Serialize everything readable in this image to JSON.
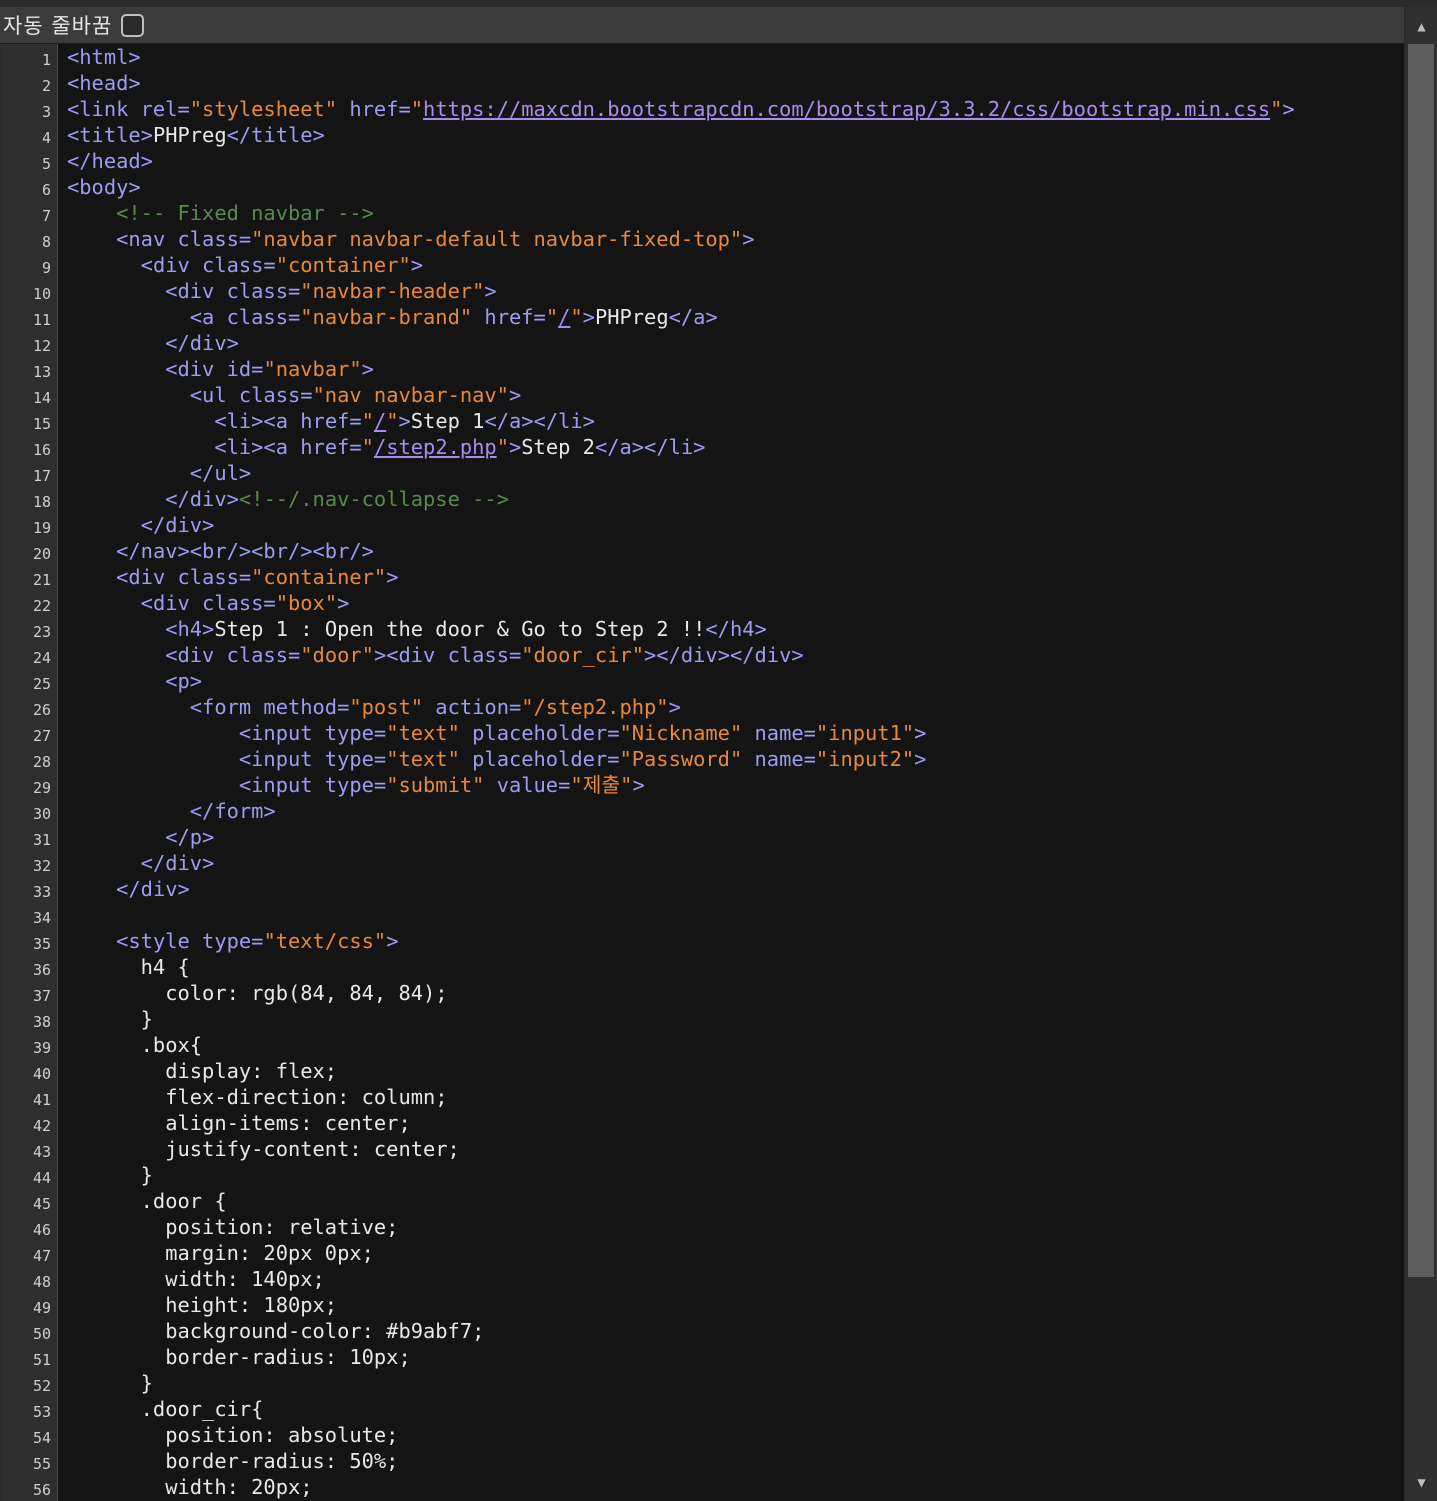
{
  "toolbar": {
    "wrap_label": "자동 줄바꿈",
    "wrap_checked": false
  },
  "scrollbar": {
    "up_icon": "▲",
    "down_icon": "▼"
  },
  "colors": {
    "tag": "#9c9cf2",
    "string": "#e8893a",
    "comment": "#5a8a4a",
    "link": "#a98cf0",
    "text": "#e8e8e8",
    "background": "#141414"
  },
  "code": [
    {
      "n": "1",
      "p": [
        [
          "<html>",
          "t"
        ]
      ]
    },
    {
      "n": "2",
      "p": [
        [
          "<head>",
          "t"
        ]
      ]
    },
    {
      "n": "3",
      "p": [
        [
          "<link rel=",
          "t"
        ],
        [
          "\"stylesheet\"",
          "s"
        ],
        [
          " href=",
          "t"
        ],
        [
          "\"",
          "s"
        ],
        [
          "https://maxcdn.bootstrapcdn.com/bootstrap/3.3.2/css/bootstrap.min.css",
          "u"
        ],
        [
          "\"",
          "s"
        ],
        [
          ">",
          "t"
        ]
      ]
    },
    {
      "n": "4",
      "p": [
        [
          "<title>",
          "t"
        ],
        [
          "PHPreg",
          ""
        ],
        [
          "</title>",
          "t"
        ]
      ]
    },
    {
      "n": "5",
      "p": [
        [
          "</head>",
          "t"
        ]
      ]
    },
    {
      "n": "6",
      "p": [
        [
          "<body>",
          "t"
        ]
      ]
    },
    {
      "n": "7",
      "p": [
        [
          "    ",
          ""
        ],
        [
          "<!-- Fixed navbar -->",
          "c"
        ]
      ]
    },
    {
      "n": "8",
      "p": [
        [
          "    ",
          ""
        ],
        [
          "<nav class=",
          "t"
        ],
        [
          "\"navbar navbar-default navbar-fixed-top\"",
          "s"
        ],
        [
          ">",
          "t"
        ]
      ]
    },
    {
      "n": "9",
      "p": [
        [
          "      ",
          ""
        ],
        [
          "<div class=",
          "t"
        ],
        [
          "\"container\"",
          "s"
        ],
        [
          ">",
          "t"
        ]
      ]
    },
    {
      "n": "10",
      "p": [
        [
          "        ",
          ""
        ],
        [
          "<div class=",
          "t"
        ],
        [
          "\"navbar-header\"",
          "s"
        ],
        [
          ">",
          "t"
        ]
      ]
    },
    {
      "n": "11",
      "p": [
        [
          "          ",
          ""
        ],
        [
          "<a class=",
          "t"
        ],
        [
          "\"navbar-brand\"",
          "s"
        ],
        [
          " href=",
          "t"
        ],
        [
          "\"",
          "s"
        ],
        [
          "/",
          "u"
        ],
        [
          "\"",
          "s"
        ],
        [
          ">",
          "t"
        ],
        [
          "PHPreg",
          ""
        ],
        [
          "</a>",
          "t"
        ]
      ]
    },
    {
      "n": "12",
      "p": [
        [
          "        ",
          ""
        ],
        [
          "</div>",
          "t"
        ]
      ]
    },
    {
      "n": "13",
      "p": [
        [
          "        ",
          ""
        ],
        [
          "<div id=",
          "t"
        ],
        [
          "\"navbar\"",
          "s"
        ],
        [
          ">",
          "t"
        ]
      ]
    },
    {
      "n": "14",
      "p": [
        [
          "          ",
          ""
        ],
        [
          "<ul class=",
          "t"
        ],
        [
          "\"nav navbar-nav\"",
          "s"
        ],
        [
          ">",
          "t"
        ]
      ]
    },
    {
      "n": "15",
      "p": [
        [
          "            ",
          ""
        ],
        [
          "<li><a href=",
          "t"
        ],
        [
          "\"",
          "s"
        ],
        [
          "/",
          "u"
        ],
        [
          "\"",
          "s"
        ],
        [
          ">",
          "t"
        ],
        [
          "Step 1",
          ""
        ],
        [
          "</a></li>",
          "t"
        ]
      ]
    },
    {
      "n": "16",
      "p": [
        [
          "            ",
          ""
        ],
        [
          "<li><a href=",
          "t"
        ],
        [
          "\"",
          "s"
        ],
        [
          "/step2.php",
          "u"
        ],
        [
          "\"",
          "s"
        ],
        [
          ">",
          "t"
        ],
        [
          "Step 2",
          ""
        ],
        [
          "</a></li>",
          "t"
        ]
      ]
    },
    {
      "n": "17",
      "p": [
        [
          "          ",
          ""
        ],
        [
          "</ul>",
          "t"
        ]
      ]
    },
    {
      "n": "18",
      "p": [
        [
          "        ",
          ""
        ],
        [
          "</div>",
          "t"
        ],
        [
          "<!--/.nav-collapse -->",
          "c"
        ]
      ]
    },
    {
      "n": "19",
      "p": [
        [
          "      ",
          ""
        ],
        [
          "</div>",
          "t"
        ]
      ]
    },
    {
      "n": "20",
      "p": [
        [
          "    ",
          ""
        ],
        [
          "</nav><br/><br/><br/>",
          "t"
        ]
      ]
    },
    {
      "n": "21",
      "p": [
        [
          "    ",
          ""
        ],
        [
          "<div class=",
          "t"
        ],
        [
          "\"container\"",
          "s"
        ],
        [
          ">",
          "t"
        ]
      ]
    },
    {
      "n": "22",
      "p": [
        [
          "      ",
          ""
        ],
        [
          "<div class=",
          "t"
        ],
        [
          "\"box\"",
          "s"
        ],
        [
          ">",
          "t"
        ]
      ]
    },
    {
      "n": "23",
      "p": [
        [
          "        ",
          ""
        ],
        [
          "<h4>",
          "t"
        ],
        [
          "Step 1 : Open the door & Go to Step 2 !!",
          ""
        ],
        [
          "</h4>",
          "t"
        ]
      ]
    },
    {
      "n": "24",
      "p": [
        [
          "        ",
          ""
        ],
        [
          "<div class=",
          "t"
        ],
        [
          "\"door\"",
          "s"
        ],
        [
          "><div class=",
          "t"
        ],
        [
          "\"door_cir\"",
          "s"
        ],
        [
          "></div></div>",
          "t"
        ]
      ]
    },
    {
      "n": "25",
      "p": [
        [
          "        ",
          ""
        ],
        [
          "<p>",
          "t"
        ]
      ]
    },
    {
      "n": "26",
      "p": [
        [
          "          ",
          ""
        ],
        [
          "<form method=",
          "t"
        ],
        [
          "\"post\"",
          "s"
        ],
        [
          " action=",
          "t"
        ],
        [
          "\"/step2.php\"",
          "s"
        ],
        [
          ">",
          "t"
        ]
      ]
    },
    {
      "n": "27",
      "p": [
        [
          "              ",
          ""
        ],
        [
          "<input type=",
          "t"
        ],
        [
          "\"text\"",
          "s"
        ],
        [
          " placeholder=",
          "t"
        ],
        [
          "\"Nickname\"",
          "s"
        ],
        [
          " name=",
          "t"
        ],
        [
          "\"input1\"",
          "s"
        ],
        [
          ">",
          "t"
        ]
      ]
    },
    {
      "n": "28",
      "p": [
        [
          "              ",
          ""
        ],
        [
          "<input type=",
          "t"
        ],
        [
          "\"text\"",
          "s"
        ],
        [
          " placeholder=",
          "t"
        ],
        [
          "\"Password\"",
          "s"
        ],
        [
          " name=",
          "t"
        ],
        [
          "\"input2\"",
          "s"
        ],
        [
          ">",
          "t"
        ]
      ]
    },
    {
      "n": "29",
      "p": [
        [
          "              ",
          ""
        ],
        [
          "<input type=",
          "t"
        ],
        [
          "\"submit\"",
          "s"
        ],
        [
          " value=",
          "t"
        ],
        [
          "\"제출\"",
          "s"
        ],
        [
          ">",
          "t"
        ]
      ]
    },
    {
      "n": "30",
      "p": [
        [
          "          ",
          ""
        ],
        [
          "</form>",
          "t"
        ]
      ]
    },
    {
      "n": "31",
      "p": [
        [
          "        ",
          ""
        ],
        [
          "</p>",
          "t"
        ]
      ]
    },
    {
      "n": "32",
      "p": [
        [
          "      ",
          ""
        ],
        [
          "</div>",
          "t"
        ]
      ]
    },
    {
      "n": "33",
      "p": [
        [
          "    ",
          ""
        ],
        [
          "</div>",
          "t"
        ]
      ]
    },
    {
      "n": "34",
      "p": []
    },
    {
      "n": "35",
      "p": [
        [
          "    ",
          ""
        ],
        [
          "<style type=",
          "t"
        ],
        [
          "\"text/css\"",
          "s"
        ],
        [
          ">",
          "t"
        ]
      ]
    },
    {
      "n": "36",
      "p": [
        [
          "      h4 {",
          ""
        ]
      ]
    },
    {
      "n": "37",
      "p": [
        [
          "        color: rgb(84, 84, 84);",
          ""
        ]
      ]
    },
    {
      "n": "38",
      "p": [
        [
          "      }",
          ""
        ]
      ]
    },
    {
      "n": "39",
      "p": [
        [
          "      .box{",
          ""
        ]
      ]
    },
    {
      "n": "40",
      "p": [
        [
          "        display: flex;",
          ""
        ]
      ]
    },
    {
      "n": "41",
      "p": [
        [
          "        flex-direction: column;",
          ""
        ]
      ]
    },
    {
      "n": "42",
      "p": [
        [
          "        align-items: center;",
          ""
        ]
      ]
    },
    {
      "n": "43",
      "p": [
        [
          "        justify-content: center;",
          ""
        ]
      ]
    },
    {
      "n": "44",
      "p": [
        [
          "      }",
          ""
        ]
      ]
    },
    {
      "n": "45",
      "p": [
        [
          "      .door {",
          ""
        ]
      ]
    },
    {
      "n": "46",
      "p": [
        [
          "        position: relative;",
          ""
        ]
      ]
    },
    {
      "n": "47",
      "p": [
        [
          "        margin: 20px 0px;",
          ""
        ]
      ]
    },
    {
      "n": "48",
      "p": [
        [
          "        width: 140px;",
          ""
        ]
      ]
    },
    {
      "n": "49",
      "p": [
        [
          "        height: 180px;",
          ""
        ]
      ]
    },
    {
      "n": "50",
      "p": [
        [
          "        background-color: #b9abf7;",
          ""
        ]
      ]
    },
    {
      "n": "51",
      "p": [
        [
          "        border-radius: 10px;",
          ""
        ]
      ]
    },
    {
      "n": "52",
      "p": [
        [
          "      }",
          ""
        ]
      ]
    },
    {
      "n": "53",
      "p": [
        [
          "      .door_cir{",
          ""
        ]
      ]
    },
    {
      "n": "54",
      "p": [
        [
          "        position: absolute;",
          ""
        ]
      ]
    },
    {
      "n": "55",
      "p": [
        [
          "        border-radius: 50%;",
          ""
        ]
      ]
    },
    {
      "n": "56",
      "p": [
        [
          "        width: 20px;",
          ""
        ]
      ]
    }
  ]
}
